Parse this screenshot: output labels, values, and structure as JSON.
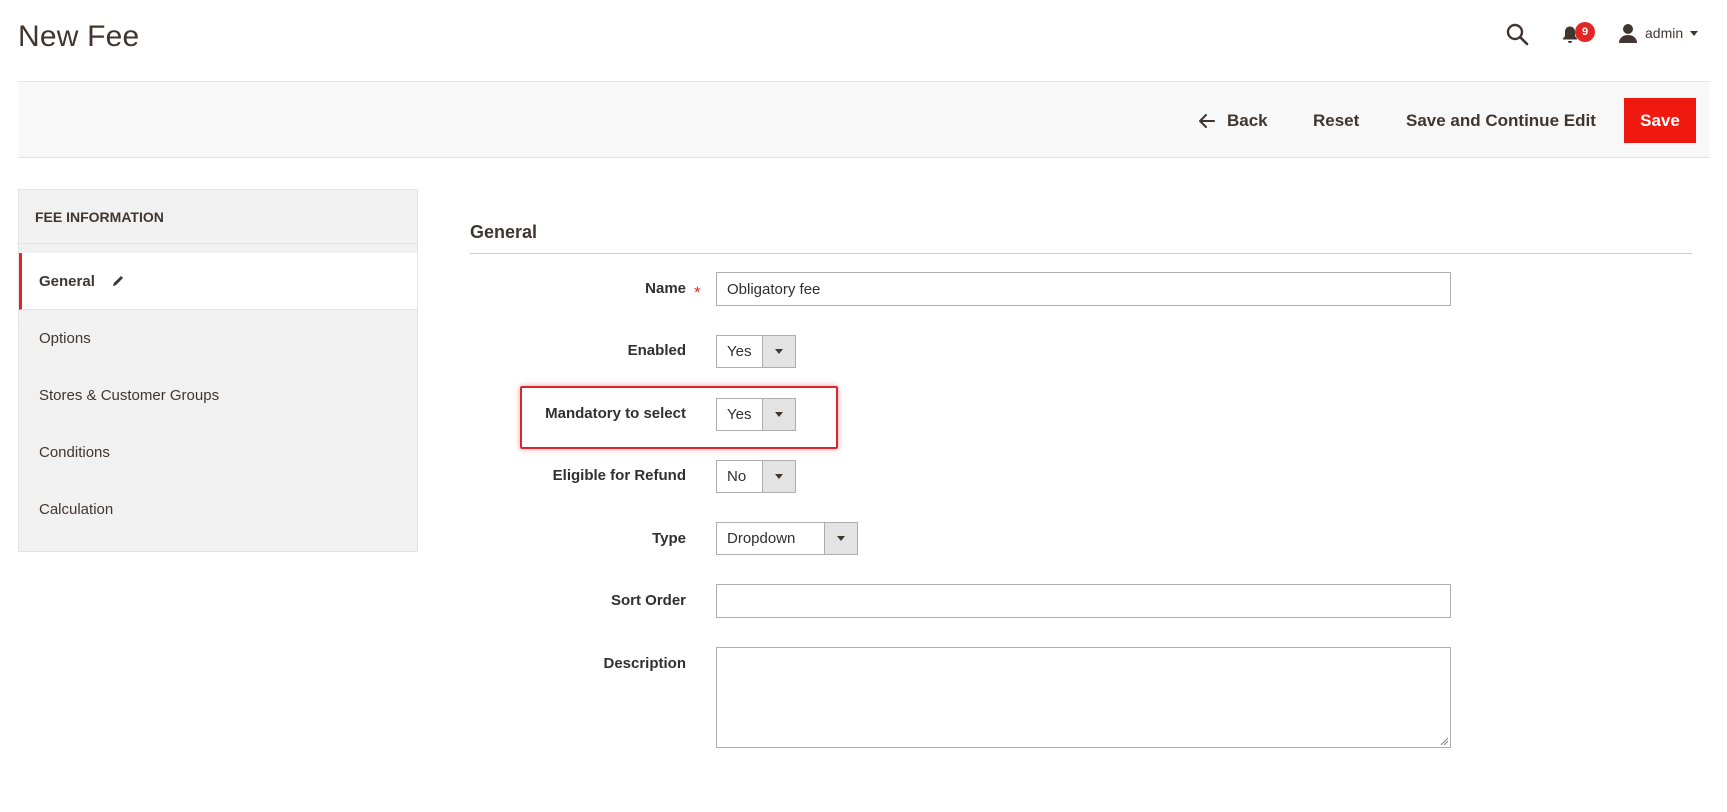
{
  "page": {
    "title": "New Fee"
  },
  "header": {
    "notification_count": "9",
    "user_name": "admin",
    "icons": {
      "search": "search-icon",
      "notifications": "bell-icon",
      "user": "user-icon"
    }
  },
  "toolbar": {
    "back_label": "Back",
    "reset_label": "Reset",
    "save_continue_label": "Save and Continue Edit",
    "save_label": "Save",
    "save_color": "#f0190f"
  },
  "sidebar": {
    "heading": "FEE INFORMATION",
    "items": [
      {
        "label": "General",
        "active": true
      },
      {
        "label": "Options"
      },
      {
        "label": "Stores & Customer Groups"
      },
      {
        "label": "Conditions"
      },
      {
        "label": "Calculation"
      }
    ]
  },
  "form": {
    "section_title": "General",
    "name": {
      "label": "Name",
      "value": "Obligatory fee",
      "required": true
    },
    "enabled": {
      "label": "Enabled",
      "value": "Yes"
    },
    "mandatory": {
      "label": "Mandatory to select",
      "value": "Yes"
    },
    "refund": {
      "label": "Eligible for Refund",
      "value": "No"
    },
    "type": {
      "label": "Type",
      "value": "Dropdown"
    },
    "sort_order": {
      "label": "Sort Order",
      "value": ""
    },
    "description": {
      "label": "Description",
      "value": ""
    }
  },
  "colors": {
    "accent": "#e22626",
    "highlight": "#d9262b"
  }
}
